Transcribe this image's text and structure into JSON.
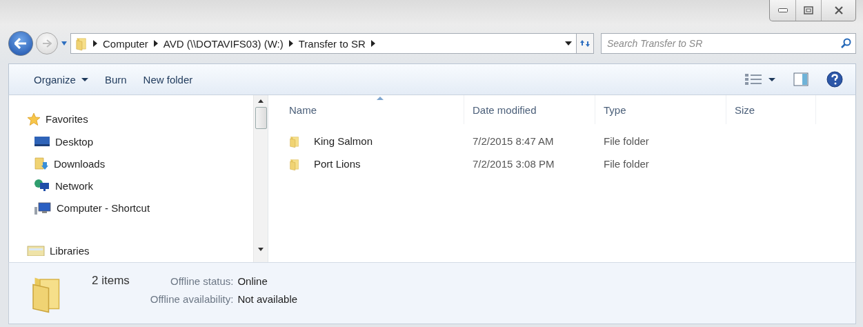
{
  "navigation": {
    "back": {
      "disabled": false
    },
    "forward": {
      "disabled": true
    }
  },
  "address_bar": {
    "breadcrumbs": [
      "Computer",
      "AVD (\\\\DOTAVIFS03) (W:)",
      "Transfer to SR"
    ]
  },
  "search": {
    "placeholder": "Search Transfer to SR"
  },
  "toolbar": {
    "items": [
      {
        "label": "Organize",
        "dropdown": true
      },
      {
        "label": "Burn",
        "dropdown": false
      },
      {
        "label": "New folder",
        "dropdown": false
      }
    ]
  },
  "sidebar": {
    "items": [
      {
        "label": "Favorites",
        "kind": "favorites",
        "children": [
          {
            "label": "Desktop",
            "kind": "desktop"
          },
          {
            "label": "Downloads",
            "kind": "downloads"
          },
          {
            "label": "Network",
            "kind": "network"
          },
          {
            "label": "Computer - Shortcut",
            "kind": "computer"
          }
        ]
      },
      {
        "label": "Libraries",
        "kind": "libraries"
      }
    ]
  },
  "table": {
    "columns": [
      {
        "label": "Name",
        "sorted": true
      },
      {
        "label": "Date modified",
        "sorted": false
      },
      {
        "label": "Type",
        "sorted": false
      },
      {
        "label": "Size",
        "sorted": false
      }
    ],
    "rows": [
      {
        "name": "King Salmon",
        "date_modified": "7/2/2015 8:47 AM",
        "type": "File folder"
      },
      {
        "name": "Port Lions",
        "date_modified": "7/2/2015 3:08 PM",
        "type": "File folder"
      }
    ]
  },
  "status_bar": {
    "item_count": "2 items",
    "details": [
      {
        "label": "Offline status:",
        "value": "Online"
      },
      {
        "label": "Offline availability:",
        "value": "Not available"
      }
    ]
  }
}
